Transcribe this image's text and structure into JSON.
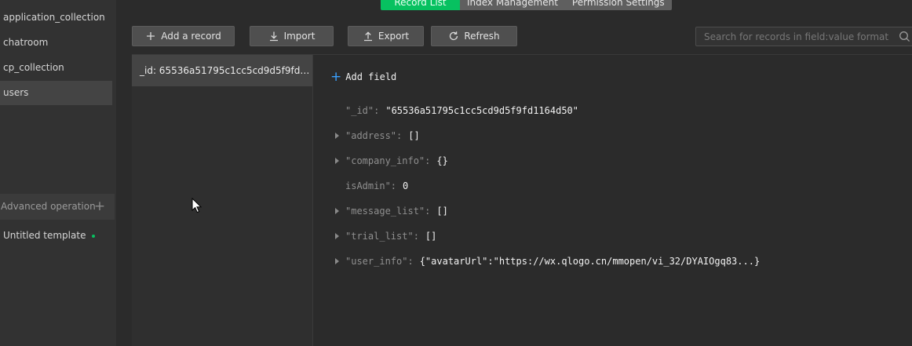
{
  "sidebar": {
    "collections": [
      "application_collection",
      "chatroom",
      "cp_collection",
      "users"
    ],
    "active_collection": "users",
    "advanced": {
      "label": "Advanced operation"
    },
    "template": {
      "label": "Untitled template"
    }
  },
  "tabs": [
    "Record List",
    "Index Management",
    "Permission Settings"
  ],
  "active_tab": "Record List",
  "toolbar": {
    "add_label": "Add a record",
    "import_label": "Import",
    "export_label": "Export",
    "refresh_label": "Refresh"
  },
  "search": {
    "placeholder": "Search for records in field:value format"
  },
  "records": [
    "_id: 65536a51795c1cc5cd9d5f9fd1164d50"
  ],
  "detail": {
    "add_field_label": "Add field",
    "fields": [
      {
        "key": "\"_id\":",
        "value": "\"65536a51795c1cc5cd9d5f9fd1164d50\"",
        "expandable": false
      },
      {
        "key": "\"address\":",
        "value": "[]",
        "expandable": true
      },
      {
        "key": "\"company_info\":",
        "value": "{}",
        "expandable": true
      },
      {
        "key": "isAdmin\":",
        "value": "0",
        "expandable": false
      },
      {
        "key": "\"message_list\":",
        "value": "[]",
        "expandable": true
      },
      {
        "key": "\"trial_list\":",
        "value": "[]",
        "expandable": true
      },
      {
        "key": "\"user_info\":",
        "value": "{\"avatarUrl\":\"https://wx.qlogo.cn/mmopen/vi_32/DYAIOgq83...}",
        "expandable": true
      }
    ]
  },
  "colors": {
    "accent": "#07c160",
    "link": "#3aa0ff",
    "background": "#2b2b2b"
  }
}
